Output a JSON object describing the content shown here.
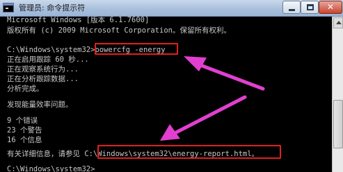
{
  "window": {
    "title": "管理员: 命令提示符",
    "close_glyph": "✕"
  },
  "console": {
    "lines": [
      "Microsoft Windows [版本 6.1.7600]",
      "版权所有 (c) 2009 Microsoft Corporation。保留所有权利。",
      "",
      "C:\\Windows\\system32>powercfg -energy",
      "正在启用跟踪 60 秒...",
      "正在观察系统行为...",
      "正在分析跟踪数据...",
      "分析完成。",
      "",
      "发现能量效率问题。",
      "",
      "9 个错误",
      "23 个警告",
      "16 个信息",
      "",
      "有关详细信息，请参见 C:\\Windows\\system32\\energy-report.html。",
      "",
      "C:\\Windows\\system32>"
    ]
  },
  "annotations": {
    "highlight_color": "#e0201e",
    "arrow_color": "#e23fd0"
  }
}
